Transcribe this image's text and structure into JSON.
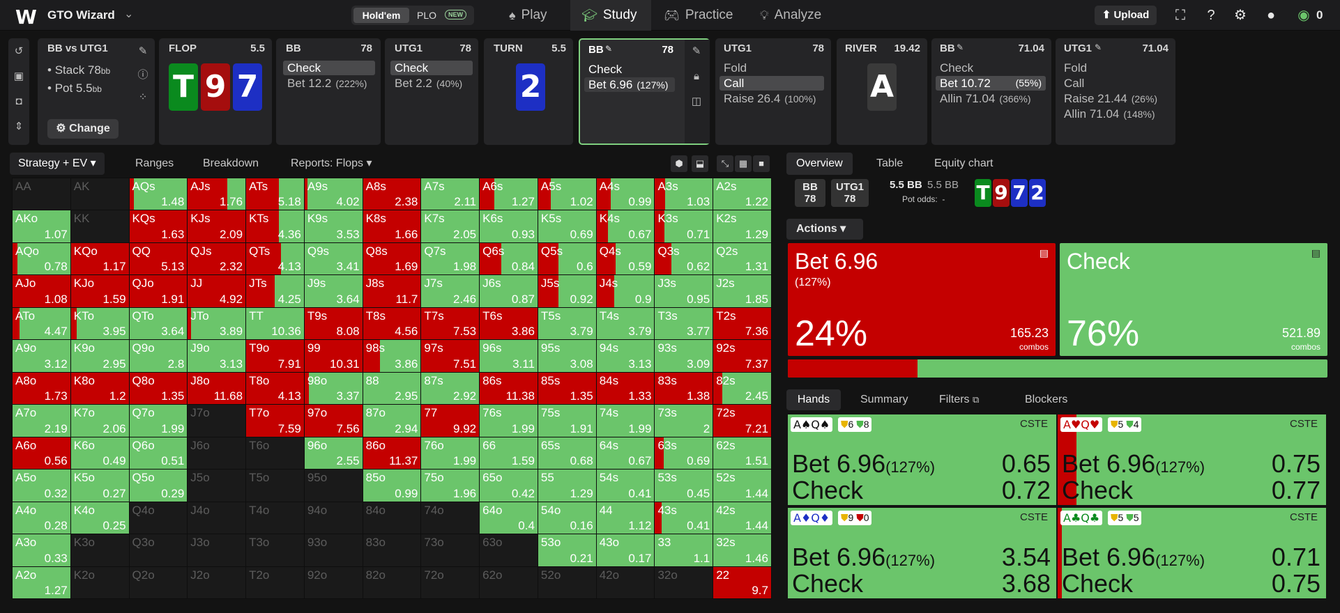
{
  "nav": {
    "title": "GTO Wizard",
    "holdem": "Hold'em",
    "plo": "PLO",
    "new_badge": "NEW",
    "items": [
      {
        "label": "Play",
        "icon": "spade-icon"
      },
      {
        "label": "Study",
        "icon": "cap-icon"
      },
      {
        "label": "Practice",
        "icon": "gamepad-icon"
      },
      {
        "label": "Analyze",
        "icon": "bulb-icon"
      }
    ],
    "upload": "Upload",
    "balance": "0"
  },
  "spot": {
    "title": "BB vs UTG1",
    "stack_label": "Stack 78",
    "stack_unit": "bb",
    "pot_label": "Pot 5.5",
    "pot_unit": "bb",
    "change": "Change"
  },
  "tree": {
    "flop": {
      "title": "FLOP",
      "val": "5.5",
      "cards": [
        {
          "r": "T",
          "c": "#0a8a1e"
        },
        {
          "r": "9",
          "c": "#a50e0e"
        },
        {
          "r": "7",
          "c": "#1d2fc4"
        }
      ]
    },
    "bb1": {
      "title": "BB",
      "val": "78",
      "actions": [
        {
          "label": "Check",
          "pct": ""
        },
        {
          "label": "Bet 12.2",
          "pct": "(222%)"
        }
      ]
    },
    "utg1a": {
      "title": "UTG1",
      "val": "78",
      "actions": [
        {
          "label": "Check",
          "pct": ""
        },
        {
          "label": "Bet 2.2",
          "pct": "(40%)"
        }
      ]
    },
    "turn": {
      "title": "TURN",
      "val": "5.5",
      "card": {
        "r": "2",
        "c": "#1d2fc4"
      }
    },
    "bb2": {
      "title": "BB",
      "val": "78",
      "actions": [
        {
          "label": "Check",
          "pct": ""
        },
        {
          "label": "Bet 6.96",
          "pct": "(127%)"
        }
      ]
    },
    "utg1b": {
      "title": "UTG1",
      "val": "78",
      "actions": [
        {
          "label": "Fold",
          "pct": ""
        },
        {
          "label": "Call",
          "pct": ""
        },
        {
          "label": "Raise 26.4",
          "pct": "(100%)"
        }
      ]
    },
    "river": {
      "title": "RIVER",
      "val": "19.42",
      "card": {
        "r": "A",
        "c": "#3a3a3a"
      }
    },
    "bb3": {
      "title": "BB",
      "val": "71.04",
      "actions": [
        {
          "label": "Check",
          "pct": ""
        },
        {
          "label": "Bet 10.72",
          "pct": "(55%)"
        },
        {
          "label": "Allin 71.04",
          "pct": "(366%)"
        }
      ]
    },
    "utg1c": {
      "title": "UTG1",
      "val": "71.04",
      "actions": [
        {
          "label": "Fold",
          "pct": ""
        },
        {
          "label": "Call",
          "pct": ""
        },
        {
          "label": "Raise 21.44",
          "pct": "(26%)"
        },
        {
          "label": "Allin 71.04",
          "pct": "(148%)"
        }
      ]
    }
  },
  "toolbar": {
    "strategy": "Strategy + EV",
    "ranges": "Ranges",
    "breakdown": "Breakdown",
    "reports": "Reports: Flops"
  },
  "grid": [
    [
      "AA|off",
      "AK|off",
      "AQs|1.48|8",
      "AJs|1.76|68",
      "ATs|5.18|57",
      "A9s|4.02|5",
      "A8s|2.38|100",
      "A7s|2.11|0",
      "A6s|1.27|25",
      "A5s|1.02|22",
      "A4s|0.99|25",
      "A3s|1.03|18",
      "A2s|1.22|0"
    ],
    [
      "AKo|1.07|0",
      "KK|off",
      "KQs|1.63|100",
      "KJs|2.09|100",
      "KTs|4.36|57",
      "K9s|3.53|0",
      "K8s|1.66|100",
      "K7s|2.05|0",
      "K6s|0.93|0",
      "K5s|0.69|0",
      "K4s|0.67|20",
      "K3s|0.71|16",
      "K2s|1.29|0"
    ],
    [
      "AQo|0.78|8",
      "KQo|1.17|100",
      "QQ|5.13|100",
      "QJs|2.32|100",
      "QTs|4.13|60",
      "Q9s|3.41|0",
      "Q8s|1.69|100",
      "Q7s|1.98|0",
      "Q6s|0.84|37",
      "Q5s|0.6|35",
      "Q4s|0.59|33",
      "Q3s|0.62|28",
      "Q2s|1.31|0"
    ],
    [
      "AJo|1.08|100",
      "KJo|1.59|100",
      "QJo|1.91|100",
      "JJ|4.92|100",
      "JTs|4.25|50",
      "J9s|3.64|0",
      "J8s|11.7|100",
      "J7s|2.46|0",
      "J6s|0.87|0",
      "J5s|0.92|35",
      "J4s|0.9|30",
      "J3s|0.95|0",
      "J2s|1.85|0"
    ],
    [
      "ATo|4.47|12",
      "KTo|3.95|10",
      "QTo|3.64|0",
      "JTo|3.89|6",
      "TT|10.36|0",
      "T9s|8.08|100",
      "T8s|4.56|100",
      "T7s|7.53|100",
      "T6s|3.86|100",
      "T5s|3.79|0",
      "T4s|3.79|0",
      "T3s|3.77|0",
      "T2s|7.36|100"
    ],
    [
      "A9o|3.12|0",
      "K9o|2.95|0",
      "Q9o|2.8|0",
      "J9o|3.13|0",
      "T9o|7.91|100",
      "99|10.31|100",
      "98s|3.86|30",
      "97s|7.51|100",
      "96s|3.11|0",
      "95s|3.08|0",
      "94s|3.13|0",
      "93s|3.09|0",
      "92s|7.37|100"
    ],
    [
      "A8o|1.73|100",
      "K8o|1.2|100",
      "Q8o|1.35|100",
      "J8o|11.68|100",
      "T8o|4.13|100",
      "98o|3.37|8",
      "88|2.95|0",
      "87s|2.92|0",
      "86s|11.38|100",
      "85s|1.35|100",
      "84s|1.33|100",
      "83s|1.38|100",
      "82s|2.45|15"
    ],
    [
      "A7o|2.19|0",
      "K7o|2.06|0",
      "Q7o|1.99|0",
      "J7o|off",
      "T7o|7.59|100",
      "97o|7.56|100",
      "87o|2.94|0",
      "77|9.92|100",
      "76s|1.99|0",
      "75s|1.91|0",
      "74s|1.99|0",
      "73s|2|0",
      "72s|7.21|100"
    ],
    [
      "A6o|0.56|100",
      "K6o|0.49|0",
      "Q6o|0.51|0",
      "J6o|off",
      "T6o|off",
      "96o|2.55|0",
      "86o|11.37|100",
      "76o|1.99|0",
      "66|1.59|0",
      "65s|0.68|0",
      "64s|0.67|0",
      "63s|0.69|15",
      "62s|1.51|0"
    ],
    [
      "A5o|0.32|0",
      "K5o|0.27|0",
      "Q5o|0.29|0",
      "J5o|off",
      "T5o|off",
      "95o|off",
      "85o|0.99|0",
      "75o|1.96|0",
      "65o|0.42|0",
      "55|1.29|0",
      "54s|0.41|0",
      "53s|0.45|0",
      "52s|1.44|0"
    ],
    [
      "A4o|0.28|0",
      "K4o|0.25|0",
      "Q4o|off",
      "J4o|off",
      "T4o|off",
      "94o|off",
      "84o|off",
      "74o|off",
      "64o|0.4|0",
      "54o|0.16|0",
      "44|1.12|0",
      "43s|0.41|12",
      "42s|1.44|0"
    ],
    [
      "A3o|0.33|0",
      "K3o|off",
      "Q3o|off",
      "J3o|off",
      "T3o|off",
      "93o|off",
      "83o|off",
      "73o|off",
      "63o|off",
      "53o|0.21|0",
      "43o|0.17|0",
      "33|1.1|0",
      "32s|1.46|0"
    ],
    [
      "A2o|1.27|0",
      "K2o|off",
      "Q2o|off",
      "J2o|off",
      "T2o|off",
      "92o|off",
      "82o|off",
      "72o|off",
      "62o|off",
      "52o|off",
      "42o|off",
      "32o|off",
      "22|9.7|100"
    ]
  ],
  "overview": {
    "tabs": [
      "Overview",
      "Table",
      "Equity chart"
    ],
    "bb_label": "BB",
    "bb_val": "78",
    "utg_label": "UTG1",
    "utg_val": "78",
    "pot_bold": "5.5 BB",
    "pot_dim": "5.5 BB",
    "pot_odds": "Pot odds:",
    "pot_odds_val": "-",
    "board": [
      {
        "r": "T",
        "c": "#0a8a1e"
      },
      {
        "r": "9",
        "c": "#a50e0e"
      },
      {
        "r": "7",
        "c": "#1d2fc4"
      },
      {
        "r": "2",
        "c": "#1d2fc4"
      }
    ]
  },
  "actions": {
    "label": "Actions",
    "bet": {
      "name": "Bet 6.96",
      "sub": "(127%)",
      "pct": "24%",
      "combos": "165.23",
      "combos_label": "combos",
      "frac": 0.24
    },
    "check": {
      "name": "Check",
      "pct": "76%",
      "combos": "521.89",
      "combos_label": "combos"
    }
  },
  "hands_tabs": {
    "hands": "Hands",
    "summary": "Summary",
    "filters": "Filters",
    "blockers": "Blockers"
  },
  "hands": [
    {
      "combo": "A♠Q♠",
      "combo_color": "#111",
      "b1": "6",
      "b2": "8",
      "b3": "",
      "cste": "CSTE",
      "bet": "Bet 6.96",
      "betpct": "(127%)",
      "bv": "0.65",
      "check": "Check",
      "cv": "0.72",
      "red": 0
    },
    {
      "combo": "A♥Q♥",
      "combo_color": "#c40000",
      "b1": "5",
      "b2": "4",
      "b3": "",
      "cste": "CSTE",
      "bet": "Bet 6.96",
      "betpct": "(127%)",
      "bv": "0.75",
      "check": "Check",
      "cv": "0.77",
      "red": 0.07
    },
    {
      "combo": "A♦Q♦",
      "combo_color": "#1d2fc4",
      "b1": "9",
      "b2": "",
      "b3": "0",
      "cste": "CSTE",
      "bet": "Bet 6.96",
      "betpct": "(127%)",
      "bv": "3.54",
      "check": "Check",
      "cv": "3.68",
      "red": 0
    },
    {
      "combo": "A♣Q♣",
      "combo_color": "#0a8a1e",
      "b1": "5",
      "b2": "5",
      "b3": "",
      "cste": "CSTE",
      "bet": "Bet 6.96",
      "betpct": "(127%)",
      "bv": "0.71",
      "check": "Check",
      "cv": "0.75",
      "red": 0.015
    }
  ],
  "colors": {
    "bet": "#c40000",
    "check": "#6bc56b",
    "off": "#1a1a1a"
  }
}
